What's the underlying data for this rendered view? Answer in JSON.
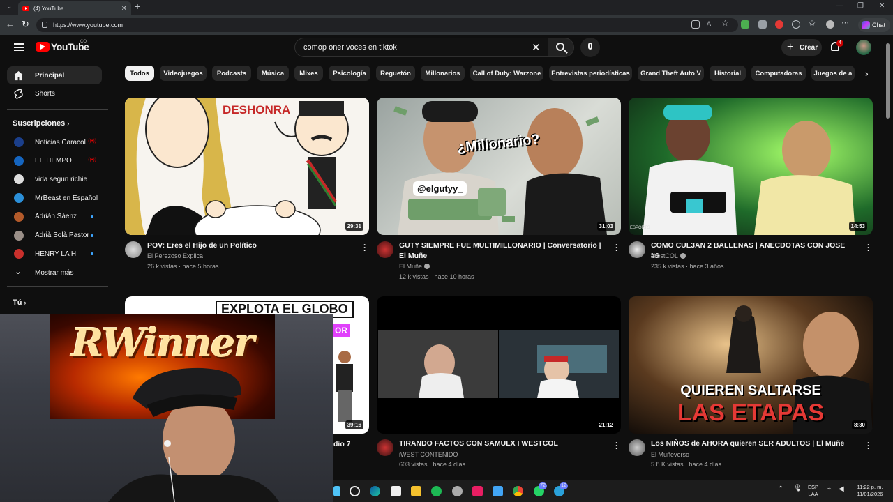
{
  "browser": {
    "tab_title": "(4) YouTube",
    "url": "https://www.youtube.com",
    "chat_label": "Chat"
  },
  "header": {
    "logo_text": "YouTube",
    "logo_country": "CO",
    "search_value": "comop oner voces en tiktok",
    "create_label": "Crear",
    "notification_count": "4"
  },
  "sidebar": {
    "main": [
      {
        "label": "Principal",
        "icon": "home-icon"
      },
      {
        "label": "Shorts",
        "icon": "shorts-icon"
      }
    ],
    "subscriptions_heading": "Suscripciones",
    "subscriptions": [
      {
        "label": "Noticias Caracol",
        "status": "live",
        "color": "#1b3f8b"
      },
      {
        "label": "EL TIEMPO",
        "status": "live",
        "color": "#1565c0"
      },
      {
        "label": "vida segun richie",
        "status": "",
        "color": "#dddddd"
      },
      {
        "label": "MrBeast en Español",
        "status": "",
        "color": "#2b8fd8"
      },
      {
        "label": "Adrián Sáenz",
        "status": "new",
        "color": "#b35a2a"
      },
      {
        "label": "Adrià Solà Pastor",
        "status": "new",
        "color": "#9a8f88"
      },
      {
        "label": "HENRY LA H",
        "status": "new",
        "color": "#c9302c"
      }
    ],
    "show_more": "Mostrar más",
    "you_heading": "Tú"
  },
  "chips": [
    "Todos",
    "Videojuegos",
    "Podcasts",
    "Música",
    "Mixes",
    "Psicología",
    "Reguetón",
    "Millonarios",
    "Call of Duty: Warzone",
    "Entrevistas periodísticas",
    "Grand Theft Auto V",
    "Historial",
    "Computadoras",
    "Juegos de a"
  ],
  "videos": [
    {
      "title": "POV: Eres el Hijo de un Político",
      "channel": "El Perezoso Explica",
      "verified": false,
      "meta": "26 k vistas · hace 5 horas",
      "duration": "29:31",
      "thumb_text": "DESHONRA"
    },
    {
      "title": "GUTY SIEMPRE FUE MULTIMILLONARIO | Conversatorio | El Muñe",
      "channel": "El Muñe",
      "verified": true,
      "meta": "12 k vistas · hace 10 horas",
      "duration": "31:03",
      "thumb_text": "¿Millonario?",
      "thumb_tag": "@elgutyy_"
    },
    {
      "title": "COMO CUL3AN 2 BALLENAS | ANECDOTAS CON JOSE #6",
      "channel": "WestCOL",
      "verified": true,
      "meta": "235 k vistas · hace 3 años",
      "duration": "14:53",
      "thumb_text": "ESPORTS"
    },
    {
      "title": "dio 7",
      "channel": "",
      "verified": false,
      "meta": "",
      "duration": "39:16",
      "thumb_text": "EXPLOTA EL GLOBO",
      "thumb_tag": "OR"
    },
    {
      "title": "TIRANDO FACTOS CON SAMULX I WESTCOL",
      "channel": "iWEST CONTENIDO",
      "verified": false,
      "meta": "603 vistas · hace 4 días",
      "duration": "21:12",
      "thumb_text": ""
    },
    {
      "title": "Los NIÑOS de AHORA quieren SER ADULTOS | El Muñe",
      "channel": "El Muñeverso",
      "verified": false,
      "meta": "5.8 K vistas · hace 4 días",
      "duration": "8:30",
      "thumb_text": "QUIEREN SALTARSE",
      "thumb_text2": "LAS ETAPAS"
    }
  ],
  "webcam": {
    "banner_text": "RWinner"
  },
  "taskbar": {
    "badge_whatsapp": "72",
    "badge_telegram": "12",
    "lang_top": "ESP",
    "lang_bottom": "LAA",
    "time": "11:22 p. m.",
    "date": "11/01/2026"
  }
}
